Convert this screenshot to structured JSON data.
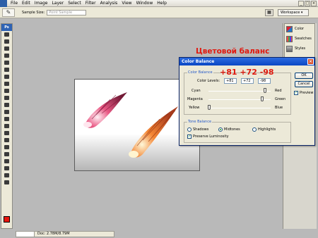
{
  "menubar": {
    "app_icon": "photoshop-logo",
    "items": [
      "File",
      "Edit",
      "Image",
      "Layer",
      "Select",
      "Filter",
      "Analysis",
      "View",
      "Window",
      "Help"
    ],
    "window_controls": [
      "_",
      "□",
      "×"
    ]
  },
  "options_bar": {
    "tool_icon": "eyedropper-icon",
    "sample_size_label": "Sample Size:",
    "sample_size_value": "Point Sample",
    "palette_icon": "palette-well-icon",
    "workspace_label": "Workspace ▾"
  },
  "toolbox": {
    "tab_label": "Ps",
    "tools": [
      "move",
      "marquee",
      "lasso",
      "quick-select",
      "crop",
      "slice",
      "healing",
      "brush",
      "clone-stamp",
      "history-brush",
      "eraser",
      "gradient",
      "blur",
      "dodge",
      "pen",
      "type",
      "path-select",
      "shape",
      "notes",
      "eyedropper",
      "hand",
      "zoom"
    ],
    "foreground_color": "#e8160f",
    "background_color": "#ffffff"
  },
  "status_bar": {
    "zoom": "",
    "doc_info": "Doc: 2.78M/8.79M"
  },
  "panels": {
    "items": [
      {
        "label": "Color",
        "icon": "color-icon"
      },
      {
        "label": "Swatches",
        "icon": "swatches-icon"
      },
      {
        "label": "Styles",
        "icon": "styles-icon"
      }
    ]
  },
  "annotation": {
    "title": "Цветовой баланс",
    "values": "+81 +72 -98",
    "color": "#e0190f"
  },
  "dialog": {
    "title": "Color Balance",
    "group_color_balance": "Color Balance",
    "color_levels_label": "Color Levels:",
    "levels": [
      "+81",
      "+72",
      "-98"
    ],
    "sliders": [
      {
        "left": "Cyan",
        "right": "Red",
        "value": 81
      },
      {
        "left": "Magenta",
        "right": "Green",
        "value": 72
      },
      {
        "left": "Yellow",
        "right": "Blue",
        "value": -98
      }
    ],
    "group_tone_balance": "Tone Balance",
    "tones": [
      "Shadows",
      "Midtones",
      "Highlights"
    ],
    "selected_tone": "Midtones",
    "preserve_luminosity": "Preserve Luminosity",
    "buttons": {
      "ok": "OK",
      "cancel": "Cancel"
    },
    "preview_label": "Preview",
    "close": "×"
  }
}
